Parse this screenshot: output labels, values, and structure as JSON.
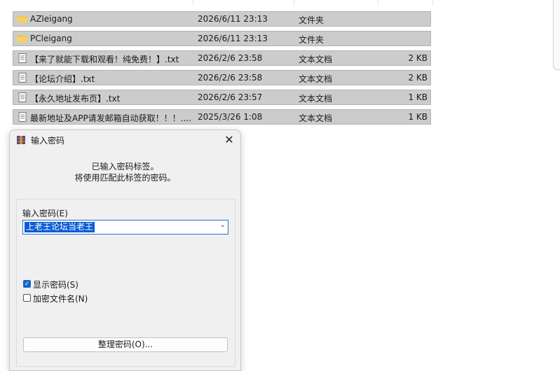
{
  "files": [
    {
      "name": "AZleigang",
      "date": "2026/6/11 23:13",
      "type": "文件夹",
      "size": "",
      "kind": "folder"
    },
    {
      "name": "PCleigang",
      "date": "2026/6/11 23:13",
      "type": "文件夹",
      "size": "",
      "kind": "folder"
    },
    {
      "name": "【来了就能下载和观看！纯免费！】.txt",
      "date": "2026/2/6 23:58",
      "type": "文本文档",
      "size": "2 KB",
      "kind": "text"
    },
    {
      "name": "【论坛介绍】.txt",
      "date": "2026/2/6 23:58",
      "type": "文本文档",
      "size": "2 KB",
      "kind": "text"
    },
    {
      "name": "【永久地址发布页】.txt",
      "date": "2026/2/6 23:57",
      "type": "文本文档",
      "size": "1 KB",
      "kind": "text"
    },
    {
      "name": "最新地址及APP请发邮箱自动获取！！！....",
      "date": "2025/3/26 1:08",
      "type": "文本文档",
      "size": "1 KB",
      "kind": "text"
    }
  ],
  "dialog": {
    "title": "输入密码",
    "close_label": "✕",
    "message_line1": "已输入密码标签。",
    "message_line2": "将使用匹配此标签的密码。",
    "password_label": "输入密码(E)",
    "password_value": "上老王论坛当老王",
    "show_password_label": "显示密码(S)",
    "show_password_checked": true,
    "encrypt_names_label": "加密文件名(N)",
    "encrypt_names_checked": false,
    "organize_button": "整理密码(O)..."
  },
  "colors": {
    "row_selected": "#cccccc",
    "accent": "#0a5bd6",
    "folder": "#f4c542"
  },
  "icons": {
    "folder": "folder-icon",
    "text": "text-file-icon",
    "app": "winrar-icon"
  }
}
